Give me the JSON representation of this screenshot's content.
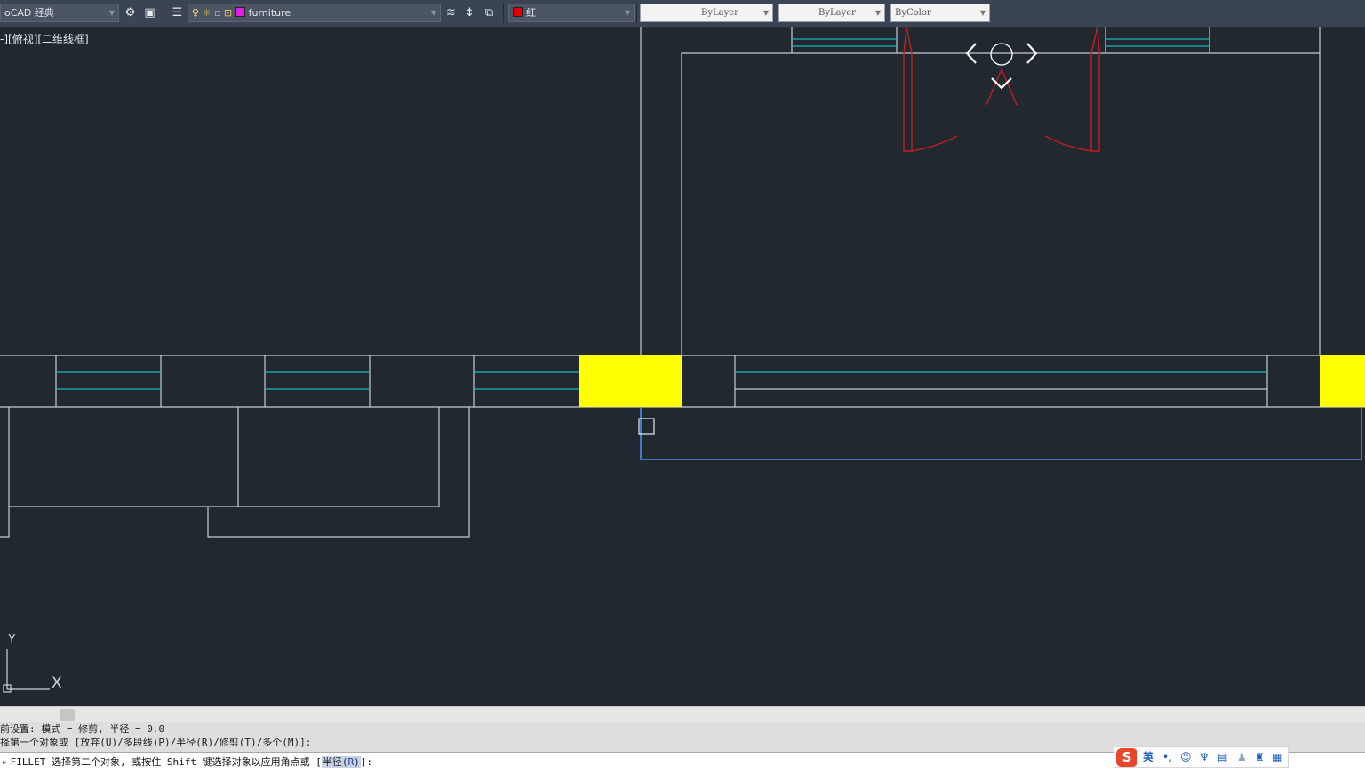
{
  "toolbar": {
    "workspace": "oCAD 经典",
    "layer_name": "furniture",
    "layer_color": "#e01ee0",
    "color_name": "红",
    "color_value": "#e00000",
    "linetype": "ByLayer",
    "lineweight": "ByLayer",
    "plotstyle": "ByColor",
    "icons": [
      "gear-icon",
      "maximize-icon",
      "layer-manager-icon",
      "bulb-icon",
      "sun-icon",
      "freeze-icon",
      "lock-icon",
      "match-layer-icon",
      "layer-previous-icon",
      "layer-state-icon"
    ]
  },
  "viewport": {
    "label": "-][俯视][二维线框]",
    "nav_icons": [
      "pan-left-icon",
      "orbit-icon",
      "pan-right-icon",
      "pan-down-icon"
    ]
  },
  "ucs": {
    "y": "Y",
    "x": "X"
  },
  "colors": {
    "background": "#212830",
    "line": "#c8cbd0",
    "cyan": "#1bb8b8",
    "red": "#c01f1f",
    "yellow": "#ffff00",
    "selection": "#4e8fe8"
  },
  "command": {
    "history": [
      "前设置: 模式 = 修剪, 半径 = 0.0",
      "择第一个对象或 [放弃(U)/多段线(P)/半径(R)/修剪(T)/多个(M)]:"
    ],
    "prefix": "▸",
    "prompt": "FILLET 选择第二个对象, 或按住 Shift 键选择对象以应用角点或 [",
    "option_label": "半径(",
    "option_key": "R",
    "option_close": ")",
    "suffix": "]:"
  },
  "ime": {
    "logo": "S",
    "mode": "英",
    "punct": "•,",
    "icons": [
      "emoji-icon",
      "microphone-icon",
      "keyboard-icon",
      "user-icon",
      "shirt-icon",
      "grid-icon"
    ]
  }
}
